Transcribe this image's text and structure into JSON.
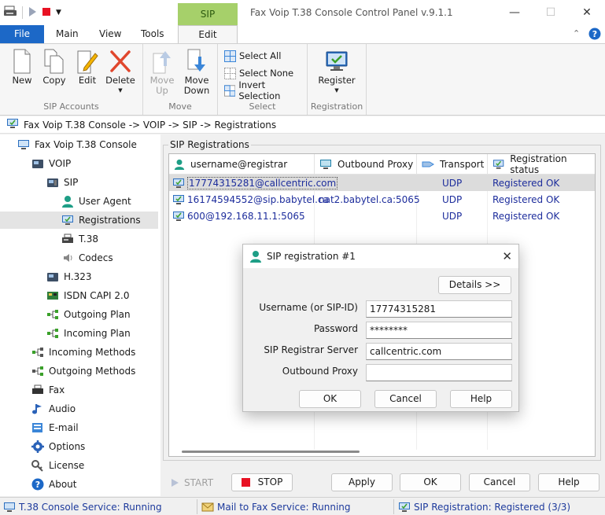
{
  "window": {
    "title": "Fax Voip T.38 Console Control Panel v.9.1.1",
    "context_tab": "SIP Accounts"
  },
  "ribbon": {
    "tabs": [
      "File",
      "Main",
      "View",
      "Tools",
      "Edit"
    ],
    "active_tab": "Edit",
    "groups": {
      "sip_accounts": {
        "label": "SIP Accounts",
        "new": "New",
        "copy": "Copy",
        "edit": "Edit",
        "delete": "Delete"
      },
      "move": {
        "label": "Move",
        "up_line1": "Move",
        "up_line2": "Up",
        "down_line1": "Move",
        "down_line2": "Down"
      },
      "select": {
        "label": "Select",
        "select_all": "Select All",
        "select_none": "Select None",
        "invert": "Invert Selection"
      },
      "registration": {
        "label": "Registration",
        "register": "Register"
      }
    }
  },
  "breadcrumb": "Fax Voip T.38 Console -> VOIP -> SIP -> Registrations",
  "tree": {
    "items": [
      {
        "label": "Fax Voip T.38 Console",
        "icon": "console-icon"
      },
      {
        "label": "VOIP",
        "icon": "voip-icon"
      },
      {
        "label": "SIP",
        "icon": "sip-phone-icon"
      },
      {
        "label": "User Agent",
        "icon": "user-icon"
      },
      {
        "label": "Registrations",
        "icon": "registrations-icon"
      },
      {
        "label": "T.38",
        "icon": "fax-machine-icon"
      },
      {
        "label": "Codecs",
        "icon": "speaker-icon"
      },
      {
        "label": "H.323",
        "icon": "h323-phone-icon"
      },
      {
        "label": "ISDN CAPI 2.0",
        "icon": "isdn-card-icon"
      },
      {
        "label": "Outgoing Plan",
        "icon": "plan-icon"
      },
      {
        "label": "Incoming Plan",
        "icon": "plan-icon"
      },
      {
        "label": "Incoming Methods",
        "icon": "methods-icon"
      },
      {
        "label": "Outgoing Methods",
        "icon": "methods-icon"
      },
      {
        "label": "Fax",
        "icon": "fax-icon"
      },
      {
        "label": "Audio",
        "icon": "audio-icon"
      },
      {
        "label": "E-mail",
        "icon": "email-icon"
      },
      {
        "label": "Options",
        "icon": "gear-icon"
      },
      {
        "label": "License",
        "icon": "key-icon"
      },
      {
        "label": "About",
        "icon": "info-icon"
      }
    ],
    "selected": "Registrations"
  },
  "registrations": {
    "panel_label": "SIP Registrations",
    "columns": [
      "username@registrar",
      "Outbound Proxy",
      "Transport",
      "Registration status"
    ],
    "rows": [
      {
        "user": "17774315281@callcentric.com",
        "proxy": "",
        "transport": "UDP",
        "status": "Registered OK"
      },
      {
        "user": "16174594552@sip.babytel.ca",
        "proxy": "nat2.babytel.ca:5065",
        "transport": "UDP",
        "status": "Registered OK"
      },
      {
        "user": "600@192.168.11.1:5065",
        "proxy": "",
        "transport": "UDP",
        "status": "Registered OK"
      }
    ]
  },
  "dialog": {
    "title": "SIP registration #1",
    "details_button": "Details >>",
    "fields": {
      "username_label": "Username (or SIP-ID)",
      "username_value": "17774315281",
      "password_label": "Password",
      "password_value": "********",
      "registrar_label": "SIP Registrar Server",
      "registrar_value": "callcentric.com",
      "proxy_label": "Outbound Proxy",
      "proxy_value": ""
    },
    "buttons": {
      "ok": "OK",
      "cancel": "Cancel",
      "help": "Help"
    }
  },
  "bottom_buttons": {
    "start": "START",
    "stop": "STOP",
    "apply": "Apply",
    "ok": "OK",
    "cancel": "Cancel",
    "help": "Help"
  },
  "status_bar": {
    "service": "T.38 Console Service: Running",
    "mail": "Mail to Fax Service: Running",
    "sip": "SIP Registration: Registered (3/3)"
  },
  "colors": {
    "file_tab": "#1c68c7",
    "context_tab": "#a6d06a",
    "link_text": "#1d2d9c",
    "stop_red": "#e81123"
  }
}
